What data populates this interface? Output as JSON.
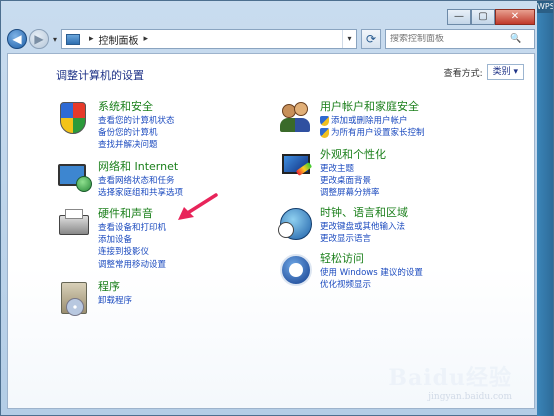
{
  "window": {
    "edge_tab_label": "WPS"
  },
  "caption": {
    "minimize": "—",
    "maximize": "▢",
    "close": "✕"
  },
  "nav": {
    "back_glyph": "◀",
    "forward_glyph": "▶",
    "dropdown_glyph": "▾",
    "address_sep": "▸",
    "address_path": "控制面板",
    "address_sep2": "▸",
    "refresh_glyph": "⟳",
    "search_placeholder": "搜索控制面板"
  },
  "header": {
    "title": "调整计算机的设置",
    "view_by_label": "查看方式:",
    "view_by_value": "类别 ▾"
  },
  "categories_left": [
    {
      "title": "系统和安全",
      "icon": "security-shield-icon",
      "links": [
        "查看您的计算机状态",
        "备份您的计算机",
        "查找并解决问题"
      ]
    },
    {
      "title": "网络和 Internet",
      "icon": "network-icon",
      "links": [
        "查看网络状态和任务",
        "选择家庭组和共享选项"
      ]
    },
    {
      "title": "硬件和声音",
      "icon": "printer-icon",
      "links": [
        "查看设备和打印机",
        "添加设备",
        "连接到投影仪",
        "调整常用移动设置"
      ]
    },
    {
      "title": "程序",
      "icon": "programs-icon",
      "links": [
        "卸载程序"
      ]
    }
  ],
  "categories_right": [
    {
      "title": "用户帐户和家庭安全",
      "icon": "users-icon",
      "links": [
        "添加或删除用户帐户",
        "为所有用户设置家长控制"
      ]
    },
    {
      "title": "外观和个性化",
      "icon": "appearance-icon",
      "links": [
        "更改主题",
        "更改桌面背景",
        "调整屏幕分辨率"
      ]
    },
    {
      "title": "时钟、语言和区域",
      "icon": "clock-globe-icon",
      "links": [
        "更改键盘或其他输入法",
        "更改显示语言"
      ]
    },
    {
      "title": "轻松访问",
      "icon": "ease-of-access-icon",
      "links": [
        "使用 Windows 建议的设置",
        "优化视频显示"
      ]
    }
  ],
  "watermark": {
    "main": "Baidu经验",
    "sub": "jingyan.baidu.com"
  },
  "colors": {
    "heading": "#1e3287",
    "category_title": "#1a7f1a",
    "link": "#1c4bbf",
    "arrow": "#e8245a"
  }
}
